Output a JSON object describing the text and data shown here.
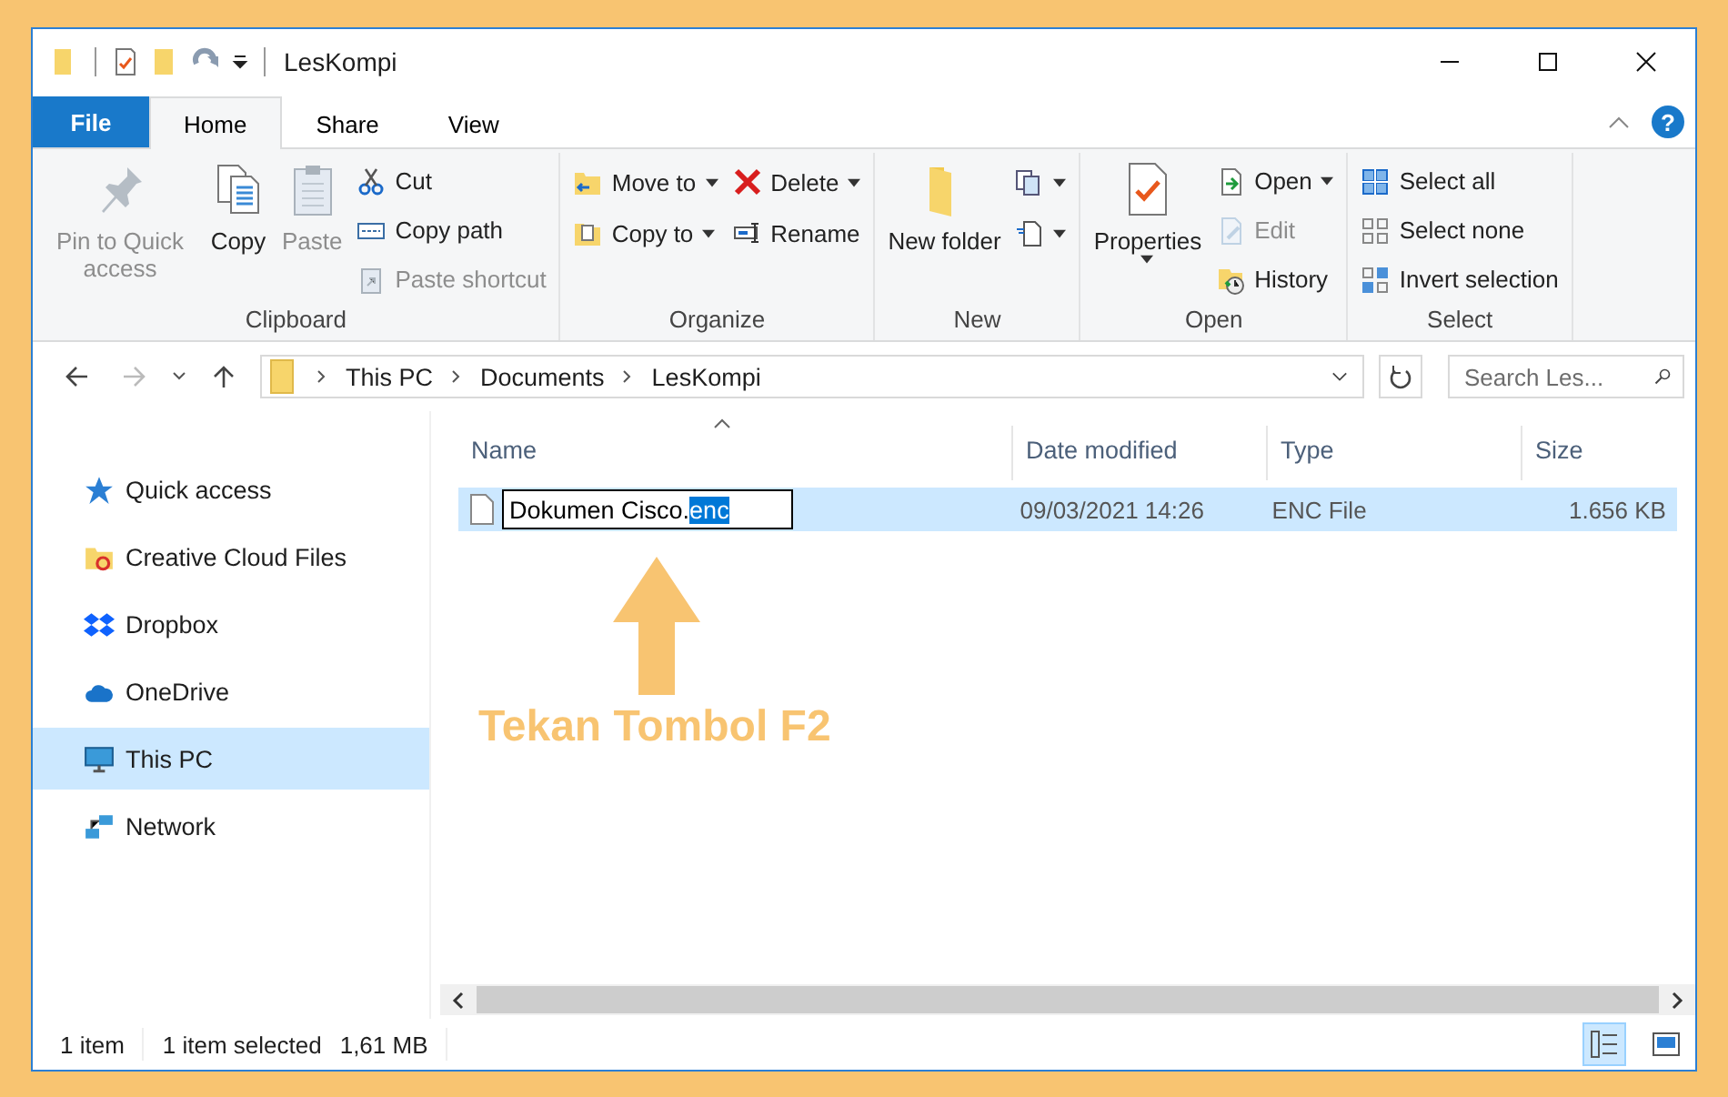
{
  "window": {
    "title": "LesKompi"
  },
  "tabs": [
    {
      "label": "File",
      "kind": "file",
      "selected": false
    },
    {
      "label": "Home",
      "kind": "tab",
      "selected": true
    },
    {
      "label": "Share",
      "kind": "tab",
      "selected": false
    },
    {
      "label": "View",
      "kind": "tab",
      "selected": false
    }
  ],
  "help": {
    "label": "?"
  },
  "ribbon": [
    {
      "label": "Clipboard",
      "columns": [
        [
          {
            "label": "Pin to Quick access",
            "kind": "large",
            "disabled": true,
            "dropdown": false
          }
        ],
        [
          {
            "label": "Copy",
            "kind": "large",
            "disabled": false,
            "dropdown": false
          }
        ],
        [
          {
            "label": "Paste",
            "kind": "large",
            "disabled": true,
            "dropdown": false
          }
        ],
        [
          {
            "label": "Cut",
            "kind": "small",
            "disabled": false,
            "dropdown": false
          },
          {
            "label": "Copy path",
            "kind": "small",
            "disabled": false,
            "dropdown": false
          },
          {
            "label": "Paste shortcut",
            "kind": "small",
            "disabled": true,
            "dropdown": false
          }
        ]
      ]
    },
    {
      "label": "Organize",
      "columns": [
        [
          {
            "label": "Move to",
            "kind": "small",
            "disabled": false,
            "dropdown": true
          },
          {
            "label": "Copy to",
            "kind": "small",
            "disabled": false,
            "dropdown": true
          }
        ],
        [
          {
            "label": "Delete",
            "kind": "small",
            "disabled": false,
            "dropdown": true
          },
          {
            "label": "Rename",
            "kind": "small",
            "disabled": false,
            "dropdown": false
          }
        ]
      ]
    },
    {
      "label": "New",
      "columns": [
        [
          {
            "label": "New folder",
            "kind": "large",
            "disabled": false,
            "dropdown": false
          }
        ],
        [
          {
            "kind": "small",
            "disabled": false,
            "dropdown": true
          },
          {
            "kind": "small",
            "disabled": false,
            "dropdown": true
          }
        ]
      ]
    },
    {
      "label": "Open",
      "columns": [
        [
          {
            "label": "Properties",
            "kind": "large",
            "disabled": false,
            "dropdown": true
          }
        ],
        [
          {
            "label": "Open",
            "kind": "small",
            "disabled": false,
            "dropdown": true
          },
          {
            "label": "Edit",
            "kind": "small",
            "disabled": true,
            "dropdown": false
          },
          {
            "label": "History",
            "kind": "small",
            "disabled": false,
            "dropdown": false
          }
        ]
      ]
    },
    {
      "label": "Select",
      "columns": [
        [
          {
            "label": "Select all",
            "kind": "small",
            "disabled": false,
            "dropdown": false
          },
          {
            "label": "Select none",
            "kind": "small",
            "disabled": false,
            "dropdown": false
          },
          {
            "label": "Invert selection",
            "kind": "small",
            "disabled": false,
            "dropdown": false
          }
        ]
      ]
    }
  ],
  "address": {
    "path": [
      "This PC",
      "Documents",
      "LesKompi"
    ]
  },
  "search": {
    "placeholder": "Search Les..."
  },
  "sidebar": {
    "items": [
      {
        "label": "Quick access",
        "selected": false
      },
      {
        "label": "Creative Cloud Files",
        "selected": false
      },
      {
        "label": "Dropbox",
        "selected": false
      },
      {
        "label": "OneDrive",
        "selected": false
      },
      {
        "label": "This PC",
        "selected": true
      },
      {
        "label": "Network",
        "selected": false
      }
    ]
  },
  "table": {
    "columns": [
      {
        "label": "Name",
        "sorted": true
      },
      {
        "label": "Date modified",
        "sorted": false
      },
      {
        "label": "Type",
        "sorted": false
      },
      {
        "label": "Size",
        "sorted": false
      }
    ],
    "rows": [
      {
        "name": "Dokumen Cisco.",
        "name_selection": "enc",
        "editing": true,
        "date": "09/03/2021 14:26",
        "type": "ENC File",
        "size": "1.656 KB",
        "selected": true
      }
    ]
  },
  "annotation": {
    "text": "Tekan Tombol F2"
  },
  "status_bar": {
    "count": "1 item",
    "selection": "1 item selected",
    "size": "1,61 MB",
    "views": [
      {
        "selected": true
      },
      {
        "selected": false
      }
    ]
  }
}
